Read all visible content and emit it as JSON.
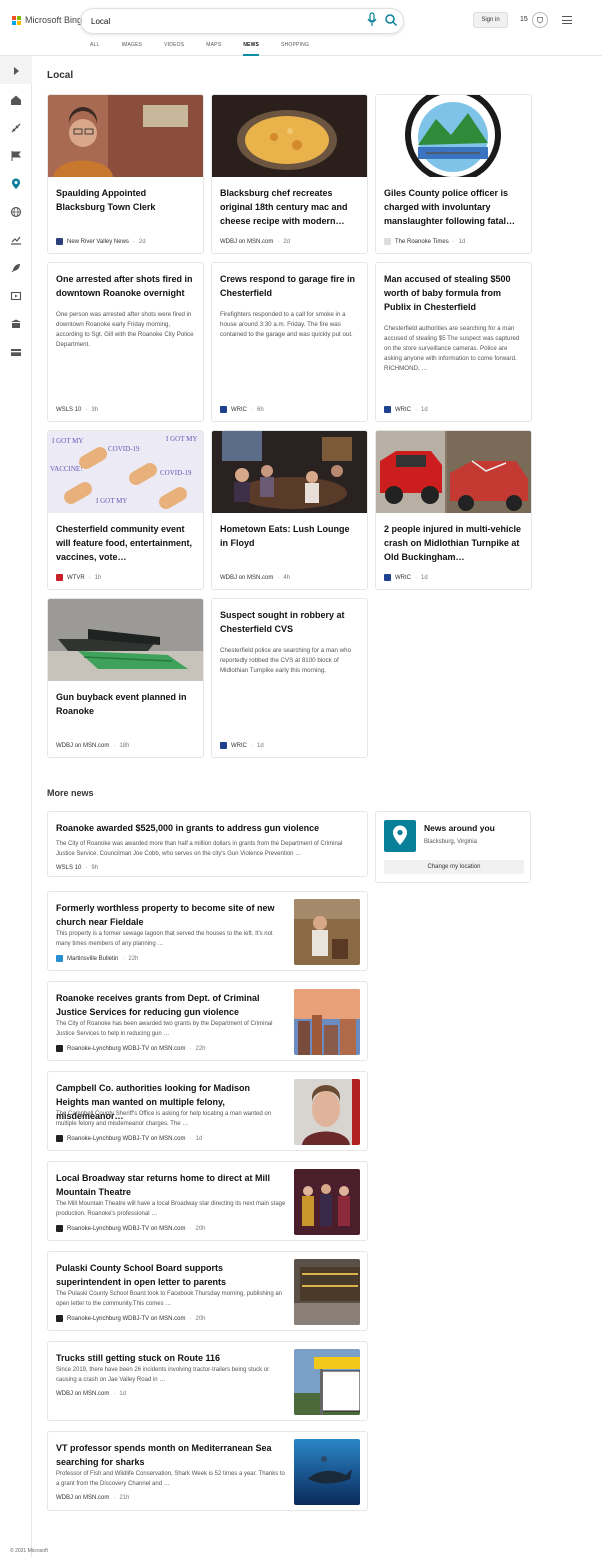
{
  "header": {
    "logo_text": "Microsoft Bing",
    "search_value": "Local",
    "sign_in": "Sign in",
    "reward_points": "15",
    "tabs": [
      {
        "label": "ALL"
      },
      {
        "label": "IMAGES"
      },
      {
        "label": "VIDEOS"
      },
      {
        "label": "MAPS"
      },
      {
        "label": "NEWS"
      },
      {
        "label": "SHOPPING"
      }
    ],
    "active_tab": "NEWS"
  },
  "sidebar": {
    "icons": [
      "expand-icon",
      "home-icon",
      "sports-icon",
      "flag-icon",
      "location-icon",
      "world-icon",
      "chart-icon",
      "rocket-icon",
      "video-icon",
      "bank-icon",
      "card-icon"
    ]
  },
  "local": {
    "title": "Local",
    "cards": [
      {
        "headline": "Spaulding Appointed Blacksburg Town Clerk",
        "source": "New River Valley News",
        "time": "2d"
      },
      {
        "headline": "Blacksburg chef recreates original 18th century mac and cheese recipe with modern…",
        "source": "WDBJ on MSN.com",
        "time": "2d"
      },
      {
        "headline": "Giles County police officer is charged with involuntary manslaughter following fatal…",
        "source": "The Roanoke Times",
        "time": "1d"
      },
      {
        "headline": "One arrested after shots fired in downtown Roanoke overnight",
        "snippet": "One person was arrested after shots were fired in downtown Roanoke early Friday morning, according to Sgt. Gill with the Roanoke City Police Department.",
        "source": "WSLS 10",
        "time": "3h"
      },
      {
        "headline": "Crews respond to garage fire in Chesterfield",
        "snippet": "Firefighters responded to a call for smoke in a house around 3:30 a.m. Friday. The fire was contained to the garage and was quickly put out.",
        "source": "WRIC",
        "time": "6h"
      },
      {
        "headline": "Man accused of stealing $500 worth of baby formula from Publix in Chesterfield",
        "snippet": "Chesterfield authorities are searching for a man accused of stealing $5 The suspect was captured on the store surveillance cameras. Police are asking anyone with information to come forward. RICHMOND, …",
        "source": "WRIC",
        "time": "1d"
      },
      {
        "headline": "Chesterfield community event will feature food, entertainment, vaccines, vote…",
        "source": "WTVR",
        "time": "1h"
      },
      {
        "headline": "Hometown Eats: Lush Lounge in Floyd",
        "source": "WDBJ on MSN.com",
        "time": "4h"
      },
      {
        "headline": "2 people injured in multi-vehicle crash on Midlothian Turnpike at Old Buckingham…",
        "source": "WRIC",
        "time": "1d"
      },
      {
        "headline": "Gun buyback event planned in Roanoke",
        "source": "WDBJ on MSN.com",
        "time": "18h"
      },
      {
        "headline": "Suspect sought in robbery at Chesterfield CVS",
        "snippet": "Chesterfield police are searching for a man who reportedly robbed the CVS at 8100 block of Midlothian Turnpike early this morning.",
        "source": "WRIC",
        "time": "1d"
      }
    ]
  },
  "more": {
    "title": "More news",
    "items": [
      {
        "headline": "Roanoke awarded $525,000 in grants to address gun violence",
        "snippet": "The City of Roanoke was awarded more than half a million dollars in grants from the Department of Criminal Justice Service. Councilman Joe Cobb, who serves on the city's Gun Violence Prevention …",
        "source": "WSLS 10",
        "time": "9h"
      },
      {
        "headline": "Formerly worthless property to become site of new church near Fieldale",
        "snippet": "This property is a former sewage lagoon that served the houses to the left. It's not many times members of any planning …",
        "source": "Martinsville Bulletin",
        "time": "22h"
      },
      {
        "headline": "Roanoke receives grants from Dept. of Criminal Justice Services for reducing gun violence",
        "snippet": "The City of Roanoke has been awarded two grants by the Department of Criminal Justice Services to help in reducing gun …",
        "source": "Roanoke-Lynchburg WDBJ-TV on MSN.com",
        "time": "22h"
      },
      {
        "headline": "Campbell Co. authorities looking for Madison Heights man wanted on multiple felony, misdemeanor…",
        "snippet": "The Campbell County Sheriff's Office is asking for help locating a man wanted on multiple felony and misdemeanor charges. The …",
        "source": "Roanoke-Lynchburg WDBJ-TV on MSN.com",
        "time": "1d"
      },
      {
        "headline": "Local Broadway star returns home to direct at Mill Mountain Theatre",
        "snippet": "The Mill Mountain Theatre will have a local Broadway star directing its next main stage production. Roanoke's professional …",
        "source": "Roanoke-Lynchburg WDBJ-TV on MSN.com",
        "time": "20h"
      },
      {
        "headline": "Pulaski County School Board supports superintendent in open letter to parents",
        "snippet": "The Pulaski County School Board took to Facebook Thursday morning, publishing an open letter to the community.This comes …",
        "source": "Roanoke-Lynchburg WDBJ-TV on MSN.com",
        "time": "20h"
      },
      {
        "headline": "Trucks still getting stuck on Route 116",
        "snippet": "Since 2019, there have been 26 incidents involving tractor-trailers being stuck or causing a crash on Jae Valley Road in …",
        "source": "WDBJ on MSN.com",
        "time": "1d"
      },
      {
        "headline": "VT professor spends month on Mediterranean Sea searching for sharks",
        "snippet": "Professor of Fish and Wildlife Conservation, Shark Week is 52 times a year. Thanks to a grant from the Discovery Channel and …",
        "source": "WDBJ on MSN.com",
        "time": "21h"
      }
    ]
  },
  "news_around": {
    "title": "News around you",
    "location": "Blacksburg, Virginia",
    "button": "Change my location"
  },
  "footer_text": "© 2021 Microsoft"
}
